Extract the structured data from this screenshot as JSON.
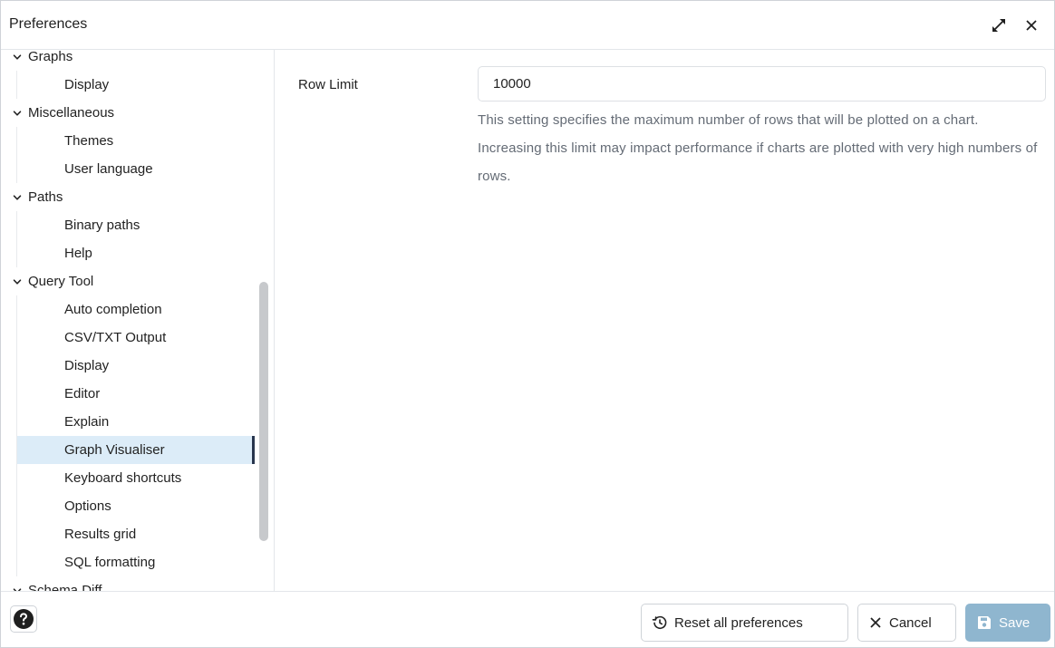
{
  "window": {
    "title": "Preferences"
  },
  "sidebar": {
    "items": [
      {
        "label": "Graphs",
        "type": "group"
      },
      {
        "label": "Display",
        "type": "leaf"
      },
      {
        "label": "Miscellaneous",
        "type": "group"
      },
      {
        "label": "Themes",
        "type": "leaf"
      },
      {
        "label": "User language",
        "type": "leaf"
      },
      {
        "label": "Paths",
        "type": "group"
      },
      {
        "label": "Binary paths",
        "type": "leaf"
      },
      {
        "label": "Help",
        "type": "leaf"
      },
      {
        "label": "Query Tool",
        "type": "group"
      },
      {
        "label": "Auto completion",
        "type": "leaf"
      },
      {
        "label": "CSV/TXT Output",
        "type": "leaf"
      },
      {
        "label": "Display",
        "type": "leaf"
      },
      {
        "label": "Editor",
        "type": "leaf"
      },
      {
        "label": "Explain",
        "type": "leaf"
      },
      {
        "label": "Graph Visualiser",
        "type": "leaf",
        "selected": true
      },
      {
        "label": "Keyboard shortcuts",
        "type": "leaf"
      },
      {
        "label": "Options",
        "type": "leaf"
      },
      {
        "label": "Results grid",
        "type": "leaf"
      },
      {
        "label": "SQL formatting",
        "type": "leaf"
      },
      {
        "label": "Schema Diff",
        "type": "group"
      }
    ]
  },
  "main": {
    "field_label": "Row Limit",
    "field_value": "10000",
    "help_text": "This setting specifies the maximum number of rows that will be plotted on a chart. Increasing this limit may impact performance if charts are plotted with very high numbers of rows."
  },
  "footer": {
    "reset_label": "Reset all preferences",
    "cancel_label": "Cancel",
    "save_label": "Save"
  },
  "icons": {
    "expand": "expand-icon",
    "close": "close-icon",
    "chevron": "chevron-down-icon",
    "help": "help-icon",
    "reset": "history-icon",
    "cancel": "close-icon",
    "save": "floppy-disk-icon"
  },
  "colors": {
    "selected_row": "#dcecf8",
    "selected_marker": "#28364e",
    "save_button": "#8fb6cf",
    "help_text": "#646b75"
  }
}
